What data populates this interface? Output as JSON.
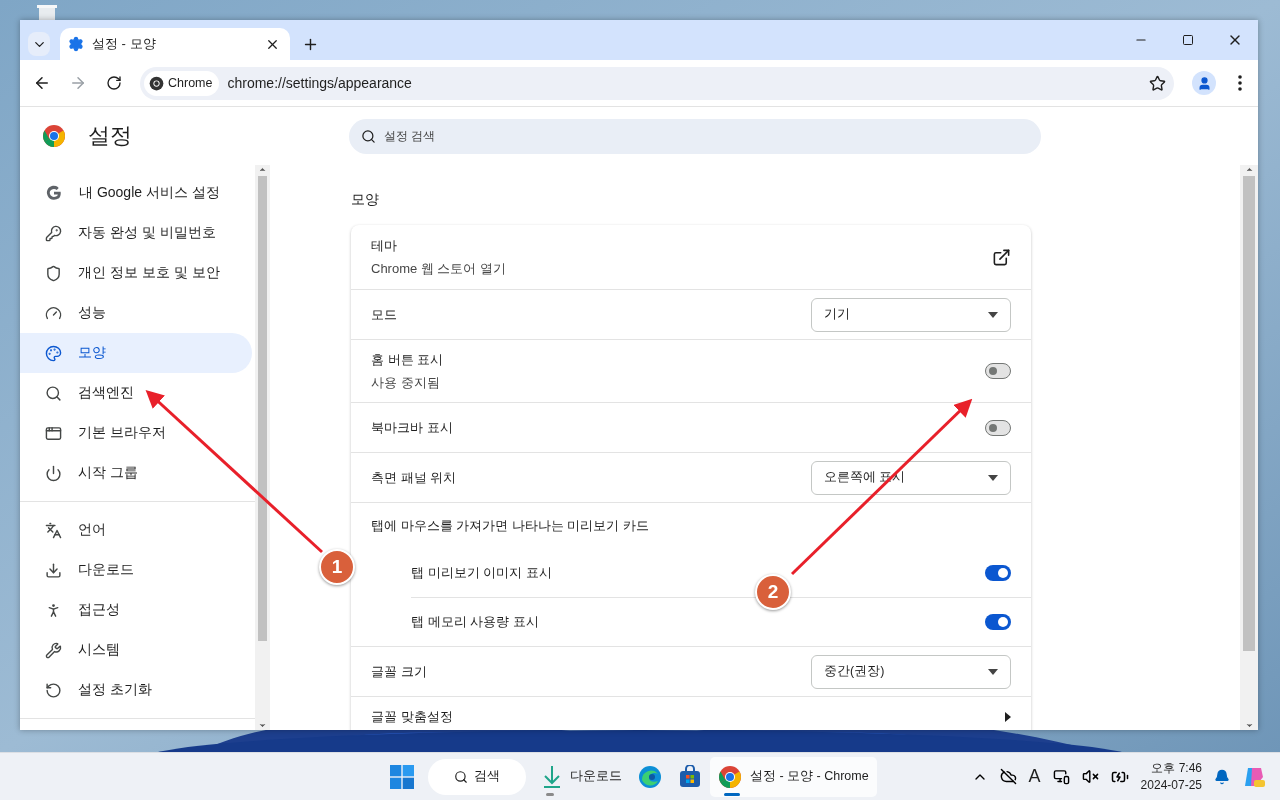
{
  "window": {
    "tab": {
      "title": "설정 - 모양",
      "selected": true
    }
  },
  "address_bar": {
    "chip": "Chrome",
    "url": "chrome://settings/appearance"
  },
  "sidebar": {
    "title": "설정",
    "groups": [
      [
        {
          "label": "내 Google 서비스 설정",
          "selected": false
        },
        {
          "label": "자동 완성 및 비밀번호",
          "selected": false
        },
        {
          "label": "개인 정보 보호 및 보안",
          "selected": false
        },
        {
          "label": "성능",
          "selected": false
        },
        {
          "label": "모양",
          "selected": true
        },
        {
          "label": "검색엔진",
          "selected": false
        },
        {
          "label": "기본 브라우저",
          "selected": false
        },
        {
          "label": "시작 그룹",
          "selected": false
        }
      ],
      [
        {
          "label": "언어",
          "selected": false
        },
        {
          "label": "다운로드",
          "selected": false
        },
        {
          "label": "접근성",
          "selected": false
        },
        {
          "label": "시스템",
          "selected": false
        },
        {
          "label": "설정 초기화",
          "selected": false
        }
      ]
    ]
  },
  "search": {
    "placeholder": "설정 검색"
  },
  "section_title": "모양",
  "settings": [
    {
      "kind": "link",
      "label": "테마",
      "sublabel": "Chrome 웹 스토어 열기"
    },
    {
      "kind": "select",
      "label": "모드",
      "value": "기기"
    },
    {
      "kind": "toggle",
      "label": "홈 버튼 표시",
      "sublabel": "사용 중지됨",
      "on": false
    },
    {
      "kind": "toggle",
      "label": "북마크바 표시",
      "on": false
    },
    {
      "kind": "select",
      "label": "측면 패널 위치",
      "value": "오른쪽에 표시"
    },
    {
      "kind": "heading",
      "label": "탭에 마우스를 가져가면 나타나는 미리보기 카드"
    },
    {
      "kind": "subtoggle",
      "label": "탭 미리보기 이미지 표시",
      "on": true
    },
    {
      "kind": "subtoggle",
      "label": "탭 메모리 사용량 표시",
      "on": true
    },
    {
      "kind": "select",
      "label": "글꼴 크기",
      "value": "중간(권장)"
    },
    {
      "kind": "submenu",
      "label": "글꼴 맞춤설정"
    }
  ],
  "annotations": [
    {
      "label": "1"
    },
    {
      "label": "2"
    }
  ],
  "taskbar": {
    "search": "검색",
    "apps": [
      {
        "label": "다운로드",
        "open": true,
        "selected": false
      },
      {
        "open": false,
        "selected": false
      },
      {
        "open": false,
        "selected": false
      },
      {
        "label": "설정 - 모양 - Chrome",
        "open": true,
        "selected": true
      }
    ],
    "ime": "A",
    "time": "오후 7:46",
    "date": "2024-07-25"
  }
}
